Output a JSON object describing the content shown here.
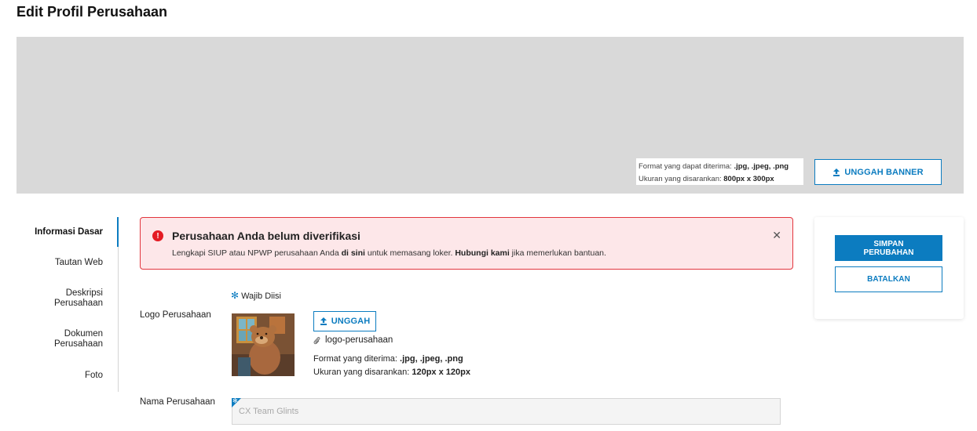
{
  "page": {
    "title": "Edit Profil Perusahaan"
  },
  "banner": {
    "format_label": "Format yang dapat diterima: ",
    "format_value": ".jpg, .jpeg, .png",
    "size_label": "Ukuran yang disarankan: ",
    "size_value": "800px x 300px",
    "upload_label": "UNGGAH BANNER"
  },
  "sidebar": {
    "items": [
      {
        "label": "Informasi Dasar"
      },
      {
        "label": "Tautan Web"
      },
      {
        "label": "Deskripsi Perusahaan"
      },
      {
        "label": "Dokumen Perusahaan"
      },
      {
        "label": "Foto"
      }
    ]
  },
  "alert": {
    "title": "Perusahaan Anda belum diverifikasi",
    "text_1": "Lengkapi SIUP atau NPWP perusahaan Anda ",
    "link_1": "di sini",
    "text_2": " untuk memasang loker. ",
    "link_2": "Hubungi kami",
    "text_3": " jika memerlukan bantuan.",
    "close": "✕"
  },
  "actions": {
    "save_label": "SIMPAN PERUBAHAN",
    "cancel_label": "BATALKAN"
  },
  "form": {
    "required_note": "Wajib Diisi",
    "logo": {
      "label": "Logo Perusahaan",
      "upload_label": "UNGGAH",
      "file_name": "logo-perusahaan",
      "format_label": "Format yang diterima: ",
      "format_value": ".jpg, .jpeg, .png",
      "size_label": "Ukuran yang disarankan: ",
      "size_value": "120px x 120px"
    },
    "company_name": {
      "label": "Nama Perusahaan",
      "placeholder": "CX Team Glints"
    }
  },
  "colors": {
    "accent": "#0c7cc0",
    "error": "#e41b23",
    "error_bg": "#fde7e9",
    "banner_bg": "#d9d9d9"
  },
  "icons": [
    "upload-icon",
    "error-icon",
    "close-icon",
    "paperclip-icon",
    "asterisk-icon"
  ]
}
